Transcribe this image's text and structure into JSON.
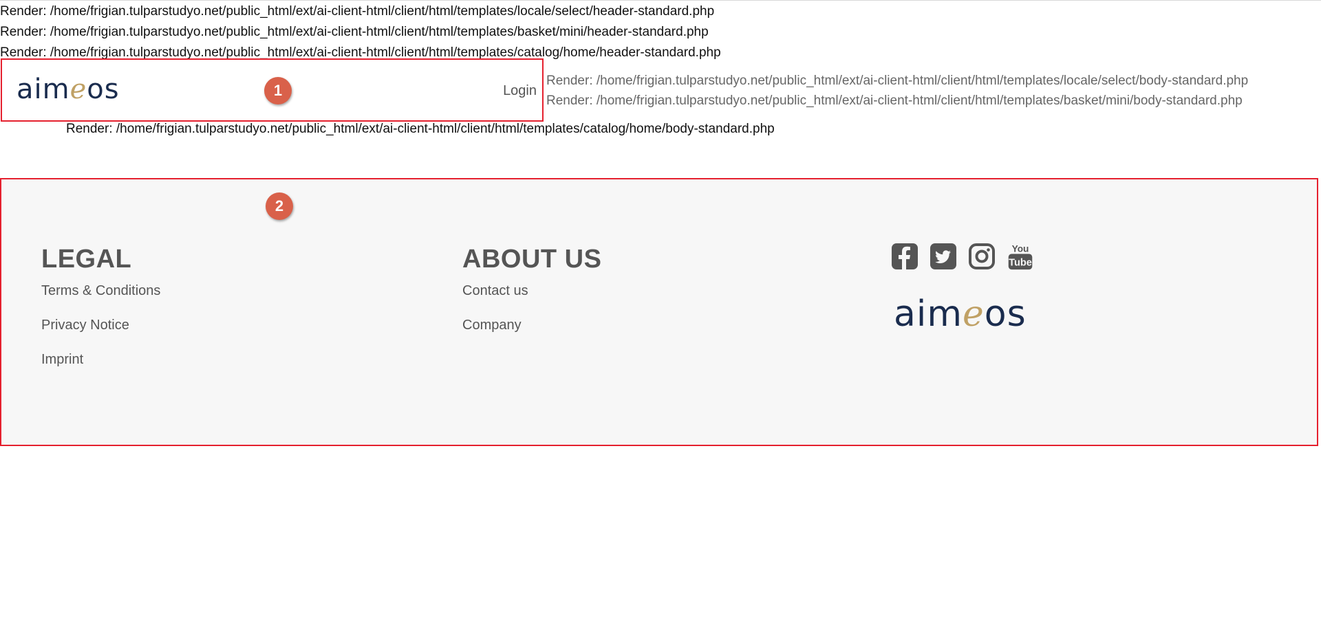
{
  "debug_lines": [
    "Render: /home/frigian.tulparstudyo.net/public_html/ext/ai-client-html/client/html/templates/locale/select/header-standard.php",
    "Render: /home/frigian.tulparstudyo.net/public_html/ext/ai-client-html/client/html/templates/basket/mini/header-standard.php",
    "Render: /home/frigian.tulparstudyo.net/public_html/ext/ai-client-html/client/html/templates/catalog/home/header-standard.php",
    "Render: /home/frigian.tulparstudyo.net/public_html/ext/ai-client-html/client/html/templates/locale/select/body-standard.php",
    "Render: /home/frigian.tulparstudyo.net/public_html/ext/ai-client-html/client/html/templates/basket/mini/body-standard.php",
    "Render: /home/frigian.tulparstudyo.net/public_html/ext/ai-client-html/client/html/templates/catalog/home/body-standard.php"
  ],
  "header": {
    "logo": {
      "part1": "aim",
      "part2": "e",
      "part3": "os"
    },
    "login_label": "Login"
  },
  "annotations": {
    "badge_1": "1",
    "badge_2": "2"
  },
  "footer": {
    "legal": {
      "heading": "LEGAL",
      "links": [
        "Terms & Conditions",
        "Privacy Notice",
        "Imprint"
      ]
    },
    "about": {
      "heading": "ABOUT US",
      "links": [
        "Contact us",
        "Company"
      ]
    },
    "social": [
      "facebook-icon",
      "twitter-icon",
      "instagram-icon",
      "youtube-icon"
    ],
    "logo": {
      "part1": "aim",
      "part2": "e",
      "part3": "os"
    }
  },
  "colors": {
    "brand_dark": "#1a2c4e",
    "brand_gold": "#c0a165",
    "annotation_red": "#e5202e",
    "badge": "#d9614a",
    "footer_bg": "#f7f7f7",
    "text_gray": "#555555"
  }
}
